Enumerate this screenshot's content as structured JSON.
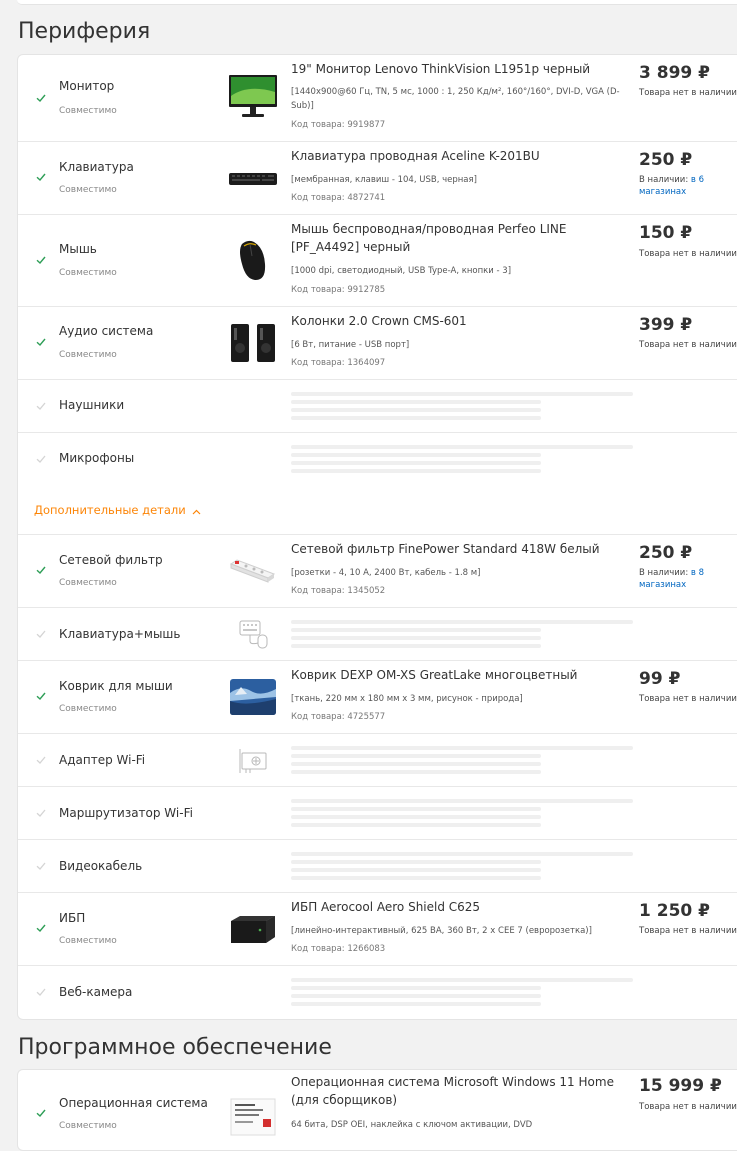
{
  "sections": {
    "peripherals_title": "Периферия",
    "software_title": "Программное обеспечение"
  },
  "labels": {
    "compatible": "Совместимо",
    "no_stock": "Товара нет в наличии",
    "in_stock_prefix": "В наличии:",
    "extra_details": "Дополнительные детали"
  },
  "peripherals": {
    "monitor": {
      "category": "Монитор",
      "title": "19\" Монитор Lenovo ThinkVision L1951p черный",
      "spec": "[1440x900@60 Гц, TN, 5 мс, 1000 : 1, 250 Кд/м², 160°/160°, DVI-D, VGA (D-Sub)]",
      "code": "Код товара: 9919877",
      "price": "3 899 ₽",
      "availability": "Товара нет в наличии"
    },
    "keyboard": {
      "category": "Клавиатура",
      "title": "Клавиатура проводная Aceline K-201BU",
      "spec": "[мембранная, клавиш - 104, USB, черная]",
      "code": "Код товара: 4872741",
      "price": "250 ₽",
      "availability_prefix": "В наличии:",
      "availability_link": "в 6 магазинах"
    },
    "mouse": {
      "category": "Мышь",
      "title": "Мышь беспроводная/проводная Perfeo LINE [PF_A4492] черный",
      "spec": "[1000 dpi, светодиодный, USB Type-A, кнопки - 3]",
      "code": "Код товара: 9912785",
      "price": "150 ₽",
      "availability": "Товара нет в наличии"
    },
    "audio": {
      "category": "Аудио система",
      "title": "Колонки 2.0 Crown CMS-601",
      "spec": "[6 Вт, питание - USB порт]",
      "code": "Код товара: 1364097",
      "price": "399 ₽",
      "availability": "Товара нет в наличии"
    },
    "headphones": {
      "category": "Наушники"
    },
    "microphones": {
      "category": "Микрофоны"
    }
  },
  "extras": {
    "surge": {
      "category": "Сетевой фильтр",
      "title": "Сетевой фильтр FinePower Standard 418W белый",
      "spec": "[розетки - 4, 10 А, 2400 Вт, кабель - 1.8 м]",
      "code": "Код товара: 1345052",
      "price": "250 ₽",
      "availability_prefix": "В наличии:",
      "availability_link": "в 8 магазинах"
    },
    "kbmouse": {
      "category": "Клавиатура+мышь"
    },
    "mousepad": {
      "category": "Коврик для мыши",
      "title": "Коврик DEXP OM-XS GreatLake многоцветный",
      "spec": "[ткань, 220 мм x 180 мм x 3 мм, рисунок - природа]",
      "code": "Код товара: 4725577",
      "price": "99 ₽",
      "availability": "Товара нет в наличии"
    },
    "wifi_adapter": {
      "category": "Адаптер Wi-Fi"
    },
    "wifi_router": {
      "category": "Маршрутизатор Wi-Fi"
    },
    "video_cable": {
      "category": "Видеокабель"
    },
    "ups": {
      "category": "ИБП",
      "title": "ИБП Aerocool Aero Shield C625",
      "spec": "[линейно-интерактивный, 625 ВА, 360 Вт, 2 x CEE 7 (евророзетка)]",
      "code": "Код товара: 1266083",
      "price": "1 250 ₽",
      "availability": "Товара нет в наличии"
    },
    "webcam": {
      "category": "Веб-камера"
    }
  },
  "software": {
    "os": {
      "category": "Операционная система",
      "title": "Операционная система Microsoft Windows 11 Home (для сборщиков)",
      "spec": "64 бита, DSP OEI, наклейка с ключом активации, DVD",
      "price": "15 999 ₽",
      "availability": "Товара нет в наличии"
    }
  },
  "colors": {
    "accent_orange": "#fc8507",
    "check_green": "#2e9e57",
    "link_blue": "#0066c0"
  },
  "icons": {
    "check": "check-icon",
    "chevron": "chevron-up-icon",
    "keyboard_mouse_placeholder": "keyboard-mouse-icon",
    "wifi_adapter_placeholder": "wifi-adapter-icon"
  }
}
